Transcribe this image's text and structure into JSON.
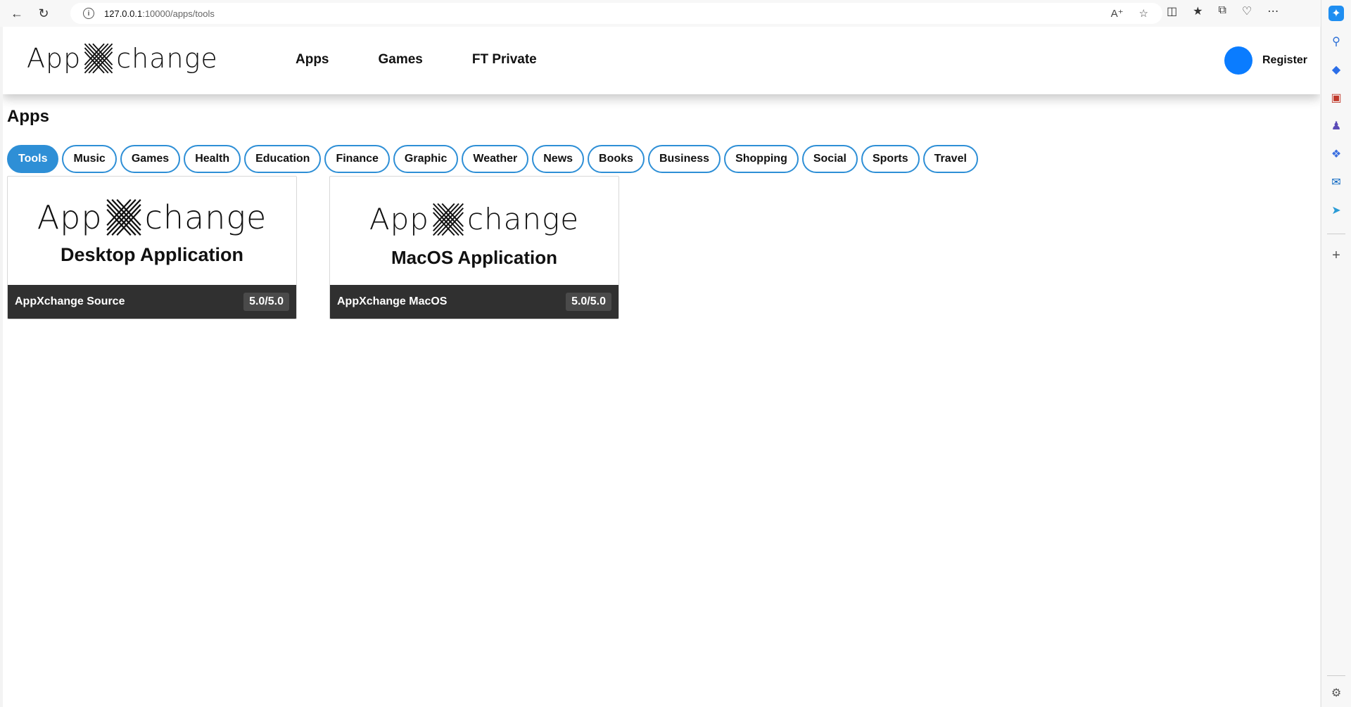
{
  "browser": {
    "url_host": "127.0.0.1",
    "url_path": ":10000/apps/tools"
  },
  "site": {
    "logo_left": "App",
    "logo_right": "change",
    "nav": [
      "Apps",
      "Games",
      "FT Private"
    ],
    "register_label": "Register",
    "avatar_color": "#0a7cff"
  },
  "page": {
    "title": "Apps",
    "categories": [
      "Tools",
      "Music",
      "Games",
      "Health",
      "Education",
      "Finance",
      "Graphic",
      "Weather",
      "News",
      "Books",
      "Business",
      "Shopping",
      "Social",
      "Sports",
      "Travel"
    ],
    "active_category": "Tools",
    "accent_color": "#2e8fd6"
  },
  "apps": [
    {
      "logo_left": "App",
      "logo_right": "change",
      "subtitle": "Desktop Application",
      "name": "AppXchange Source",
      "rating": "5.0/5.0"
    },
    {
      "logo_left": "App",
      "logo_right": "change",
      "subtitle": "MacOS Application",
      "name": "AppXchange MacOS",
      "rating": "5.0/5.0"
    }
  ]
}
